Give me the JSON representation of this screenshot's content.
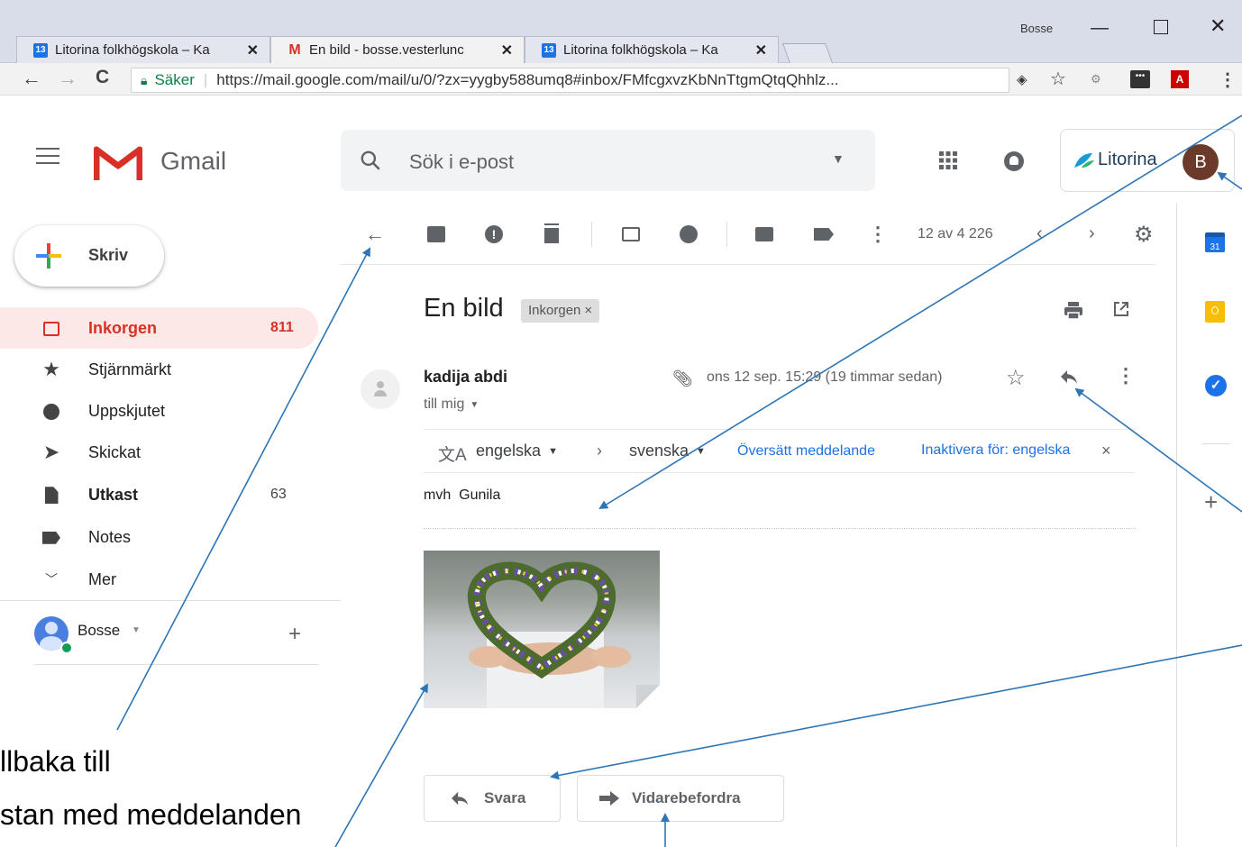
{
  "browser": {
    "user": "Bosse",
    "tabs": [
      {
        "label": "Litorina folkhögskola – Ka",
        "favicon": "13",
        "active": false
      },
      {
        "label": "En bild - bosse.vesterlunc",
        "favicon": "M",
        "active": true
      },
      {
        "label": "Litorina folkhögskola – Ka",
        "favicon": "13",
        "active": false
      }
    ],
    "secure_label": "Säker",
    "url": "https://mail.google.com/mail/u/0/?zx=yygby588umq8#inbox/FMfcgxvzKbNnTtgmQtqQhhlz..."
  },
  "gmail": {
    "logo_text": "Gmail",
    "search_placeholder": "Sök i e-post",
    "org_name": "Litorina",
    "avatar_letter": "B",
    "compose_label": "Skriv",
    "nav": [
      {
        "label": "Inkorgen",
        "count": "811",
        "icon": "inbox-icon",
        "active": true
      },
      {
        "label": "Stjärnmärkt",
        "count": "",
        "icon": "star-icon"
      },
      {
        "label": "Uppskjutet",
        "count": "",
        "icon": "clock-icon"
      },
      {
        "label": "Skickat",
        "count": "",
        "icon": "send-icon"
      },
      {
        "label": "Utkast",
        "count": "63",
        "icon": "draft-icon",
        "bold": true
      },
      {
        "label": "Notes",
        "count": "",
        "icon": "label-icon"
      },
      {
        "label": "Mer",
        "count": "",
        "icon": "chevron-down-icon"
      }
    ],
    "account_label": "Bosse",
    "pager": "12 av 4 226",
    "email": {
      "subject": "En bild",
      "label_chip": "Inkorgen",
      "sender": "kadija abdi",
      "recipient": "till mig",
      "date": "ons 12 sep. 15:29 (19 timmar sedan)",
      "translate": {
        "from_lang": "engelska",
        "to_lang": "svenska",
        "translate_link": "Översätt meddelande",
        "disable_link": "Inaktivera för: engelska"
      },
      "body": "mvh  Gunila",
      "reply_label": "Svara",
      "forward_label": "Vidarebefordra"
    }
  },
  "annotation": {
    "line1": "llbaka till",
    "line2": "stan med meddelanden"
  },
  "colors": {
    "accent_red": "#d93025",
    "active_nav_bg": "#fce8e6",
    "annotation_arrow": "#2e75b6",
    "link_blue": "#1a73e8"
  }
}
